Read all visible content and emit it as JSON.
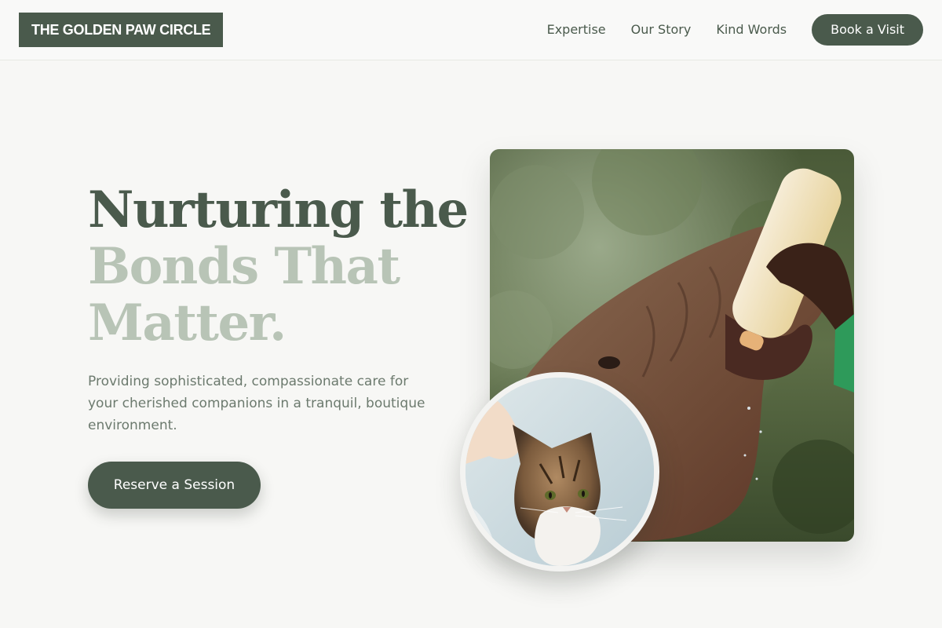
{
  "header": {
    "logo": "THE GOLDEN PAW CIRCLE",
    "nav": [
      "Expertise",
      "Our Story",
      "Kind Words"
    ],
    "cta": "Book a Visit"
  },
  "hero": {
    "title_line1": "Nurturing the",
    "title_line2": "Bonds That",
    "title_line3": "Matter.",
    "description": "Providing sophisticated, compassionate care for your cherished companions in a tranquil, boutique environment.",
    "cta": "Reserve a Session"
  },
  "images": {
    "main": "elephant-feeding-photo",
    "secondary": "cat-photo"
  },
  "colors": {
    "brand": "#4a5a4c",
    "accent_light": "#b8c4b6",
    "background": "#f7f7f5"
  }
}
